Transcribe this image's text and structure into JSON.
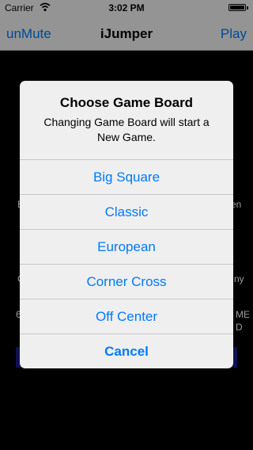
{
  "status_bar": {
    "carrier": "Carrier",
    "time": "3:02 PM",
    "wifi_icon": "wifi-icon",
    "battery_icon": "battery-icon",
    "battery_level": 1.0
  },
  "nav": {
    "left": "unMute",
    "title": "iJumper",
    "right": "Play"
  },
  "background": {
    "fragments": [
      "B",
      "en",
      "C",
      "ny",
      "6",
      "ME",
      "D"
    ]
  },
  "alert": {
    "title": "Choose Game Board",
    "message": "Changing Game Board will start a New Game.",
    "buttons": [
      "Big Square",
      "Classic",
      "European",
      "Corner Cross",
      "Off Center"
    ],
    "cancel": "Cancel"
  },
  "colors": {
    "accent": "#007aff",
    "bar_bg": "#f7f7f7",
    "alert_bg": "#efefef",
    "screen_bg": "#000000"
  }
}
